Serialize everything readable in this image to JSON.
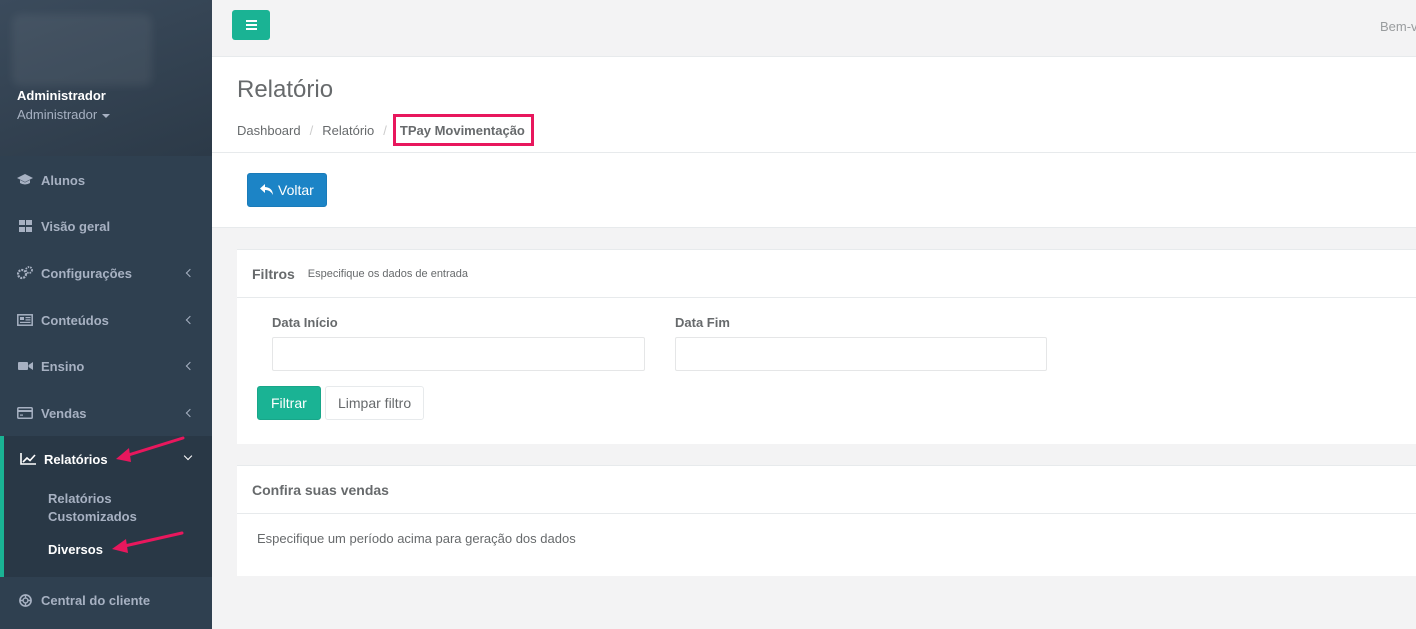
{
  "user": {
    "name": "Administrador",
    "role": "Administrador"
  },
  "topbar": {
    "welcome": "Bem-v"
  },
  "sidebar": {
    "items": [
      {
        "label": "Alunos",
        "icon": "graduation-cap-icon"
      },
      {
        "label": "Visão geral",
        "icon": "th-large-icon"
      },
      {
        "label": "Configurações",
        "icon": "cogs-icon"
      },
      {
        "label": "Conteúdos",
        "icon": "newspaper-icon"
      },
      {
        "label": "Ensino",
        "icon": "video-camera-icon"
      },
      {
        "label": "Vendas",
        "icon": "credit-card-icon"
      },
      {
        "label": "Relatórios",
        "icon": "line-chart-icon"
      },
      {
        "label": "Central do cliente",
        "icon": "life-ring-icon"
      }
    ],
    "submenu": [
      "Relatórios Customizados",
      "Diversos"
    ]
  },
  "header": {
    "title": "Relatório",
    "breadcrumb": [
      "Dashboard",
      "Relatório",
      "TPay Movimentação"
    ]
  },
  "actions": {
    "back_label": "Voltar"
  },
  "filters": {
    "title": "Filtros",
    "subtitle": "Especifique os dados de entrada",
    "start_label": "Data Início",
    "end_label": "Data Fim",
    "start_value": "",
    "end_value": "",
    "filter_button": "Filtrar",
    "clear_button": "Limpar filtro"
  },
  "sales": {
    "title": "Confira suas vendas",
    "empty_message": "Especifique um período acima para geração dos dados"
  },
  "colors": {
    "primary": "#1ab394",
    "info": "#1c84c6",
    "sidebar": "#2f4050",
    "annotation": "#e8175d"
  }
}
